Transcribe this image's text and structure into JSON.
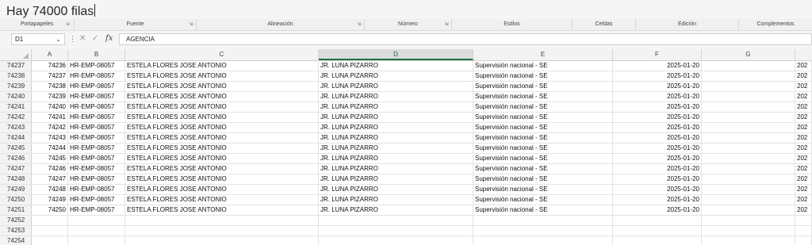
{
  "title": "Hay 74000 filas",
  "ribbon": {
    "groups": [
      "Portapapeles",
      "Fuente",
      "Alineación",
      "Número",
      "Estilos",
      "Celdas",
      "Edición",
      "Complementos"
    ]
  },
  "formula_bar": {
    "name_box": "D1",
    "formula": "AGENCIA"
  },
  "grid": {
    "columns": [
      "A",
      "B",
      "C",
      "D",
      "E",
      "F",
      "G"
    ],
    "selected_column": "D",
    "rows": [
      {
        "n": "74237",
        "a": "74236",
        "b": "HR-EMP-08057",
        "c": "ESTELA FLORES JOSE ANTONIO",
        "d": "JR. LUNA PIZARRO",
        "e": "Supervisión nacional  - SE",
        "f": "2025-01-20",
        "h": "202"
      },
      {
        "n": "74238",
        "a": "74237",
        "b": "HR-EMP-08057",
        "c": "ESTELA FLORES JOSE ANTONIO",
        "d": "JR. LUNA PIZARRO",
        "e": "Supervisión nacional  - SE",
        "f": "2025-01-20",
        "h": "202"
      },
      {
        "n": "74239",
        "a": "74238",
        "b": "HR-EMP-08057",
        "c": "ESTELA FLORES JOSE ANTONIO",
        "d": "JR. LUNA PIZARRO",
        "e": "Supervisión nacional  - SE",
        "f": "2025-01-20",
        "h": "202"
      },
      {
        "n": "74240",
        "a": "74239",
        "b": "HR-EMP-08057",
        "c": "ESTELA FLORES JOSE ANTONIO",
        "d": "JR. LUNA PIZARRO",
        "e": "Supervisión nacional  - SE",
        "f": "2025-01-20",
        "h": "202"
      },
      {
        "n": "74241",
        "a": "74240",
        "b": "HR-EMP-08057",
        "c": "ESTELA FLORES JOSE ANTONIO",
        "d": "JR. LUNA PIZARRO",
        "e": "Supervisión nacional  - SE",
        "f": "2025-01-20",
        "h": "202"
      },
      {
        "n": "74242",
        "a": "74241",
        "b": "HR-EMP-08057",
        "c": "ESTELA FLORES JOSE ANTONIO",
        "d": "JR. LUNA PIZARRO",
        "e": "Supervisión nacional  - SE",
        "f": "2025-01-20",
        "h": "202"
      },
      {
        "n": "74243",
        "a": "74242",
        "b": "HR-EMP-08057",
        "c": "ESTELA FLORES JOSE ANTONIO",
        "d": "JR. LUNA PIZARRO",
        "e": "Supervisión nacional  - SE",
        "f": "2025-01-20",
        "h": "202"
      },
      {
        "n": "74244",
        "a": "74243",
        "b": "HR-EMP-08057",
        "c": "ESTELA FLORES JOSE ANTONIO",
        "d": "JR. LUNA PIZARRO",
        "e": "Supervisión nacional  - SE",
        "f": "2025-01-20",
        "h": "202"
      },
      {
        "n": "74245",
        "a": "74244",
        "b": "HR-EMP-08057",
        "c": "ESTELA FLORES JOSE ANTONIO",
        "d": "JR. LUNA PIZARRO",
        "e": "Supervisión nacional  - SE",
        "f": "2025-01-20",
        "h": "202"
      },
      {
        "n": "74246",
        "a": "74245",
        "b": "HR-EMP-08057",
        "c": "ESTELA FLORES JOSE ANTONIO",
        "d": "JR. LUNA PIZARRO",
        "e": "Supervisión nacional  - SE",
        "f": "2025-01-20",
        "h": "202"
      },
      {
        "n": "74247",
        "a": "74246",
        "b": "HR-EMP-08057",
        "c": "ESTELA FLORES JOSE ANTONIO",
        "d": "JR. LUNA PIZARRO",
        "e": "Supervisión nacional  - SE",
        "f": "2025-01-20",
        "h": "202"
      },
      {
        "n": "74248",
        "a": "74247",
        "b": "HR-EMP-08057",
        "c": "ESTELA FLORES JOSE ANTONIO",
        "d": "JR. LUNA PIZARRO",
        "e": "Supervisión nacional  - SE",
        "f": "2025-01-20",
        "h": "202"
      },
      {
        "n": "74249",
        "a": "74248",
        "b": "HR-EMP-08057",
        "c": "ESTELA FLORES JOSE ANTONIO",
        "d": "JR. LUNA PIZARRO",
        "e": "Supervisión nacional  - SE",
        "f": "2025-01-20",
        "h": "202"
      },
      {
        "n": "74250",
        "a": "74249",
        "b": "HR-EMP-08057",
        "c": "ESTELA FLORES JOSE ANTONIO",
        "d": "JR. LUNA PIZARRO",
        "e": "Supervisión nacional  - SE",
        "f": "2025-01-20",
        "h": "202"
      },
      {
        "n": "74251",
        "a": "74250",
        "b": "HR-EMP-08057",
        "c": "ESTELA FLORES JOSE ANTONIO",
        "d": "JR. LUNA PIZARRO",
        "e": "Supervisión nacional  - SE",
        "f": "2025-01-20",
        "h": "202"
      },
      {
        "n": "74252",
        "a": "",
        "b": "",
        "c": "",
        "d": "",
        "e": "",
        "f": "",
        "h": ""
      },
      {
        "n": "74253",
        "a": "",
        "b": "",
        "c": "",
        "d": "",
        "e": "",
        "f": "",
        "h": ""
      },
      {
        "n": "74254",
        "a": "",
        "b": "",
        "c": "",
        "d": "",
        "e": "",
        "f": "",
        "h": ""
      }
    ]
  }
}
